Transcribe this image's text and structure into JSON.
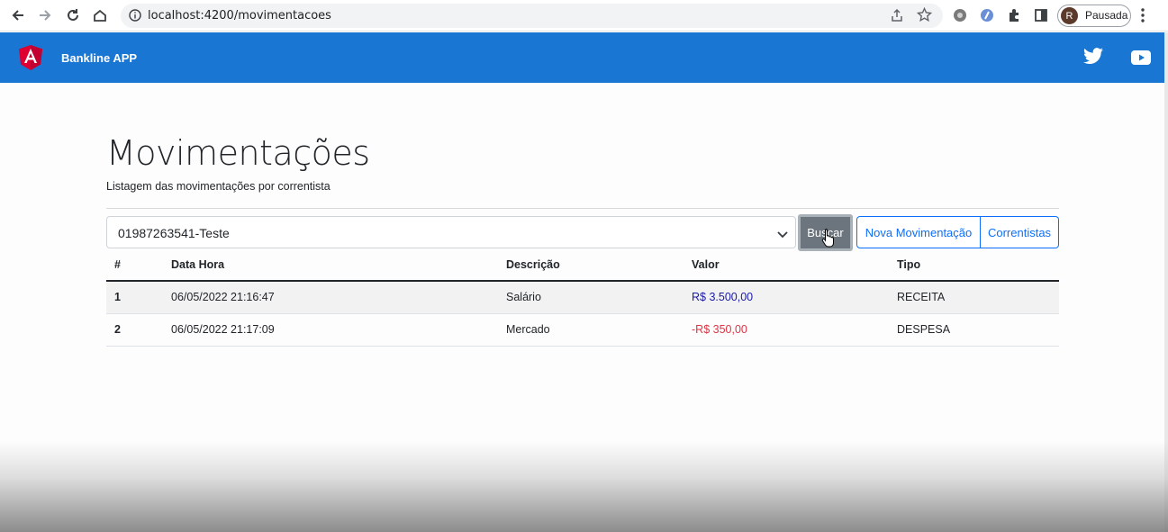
{
  "browser": {
    "url": "localhost:4200/movimentacoes",
    "profile_initial": "R",
    "profile_label": "Pausada",
    "icons": [
      "back-arrow-icon",
      "forward-arrow-icon",
      "reload-icon",
      "home-icon",
      "info-icon",
      "share-icon",
      "star-icon",
      "extension-icon",
      "puzzle-icon",
      "side-panel-icon",
      "menu-dots-icon"
    ]
  },
  "app": {
    "brand": "Bankline APP",
    "brand_color": "#1976d2",
    "social_icons": [
      "twitter-icon",
      "youtube-icon"
    ]
  },
  "page": {
    "title": "Movimentações",
    "subtitle": "Listagem das movimentações por correntista"
  },
  "filter": {
    "selected": "01987263541-Teste",
    "search_label": "Buscar",
    "new_label": "Nova Movimentação",
    "accounts_label": "Correntistas"
  },
  "table": {
    "headers": [
      "#",
      "Data Hora",
      "Descrição",
      "Valor",
      "Tipo"
    ],
    "rows": [
      {
        "id": "1",
        "datetime": "06/05/2022 21:16:47",
        "description": "Salário",
        "value": "R$ 3.500,00",
        "type": "RECEITA"
      },
      {
        "id": "2",
        "datetime": "06/05/2022 21:17:09",
        "description": "Mercado",
        "value": "-R$ 350,00",
        "type": "DESPESA"
      }
    ]
  }
}
